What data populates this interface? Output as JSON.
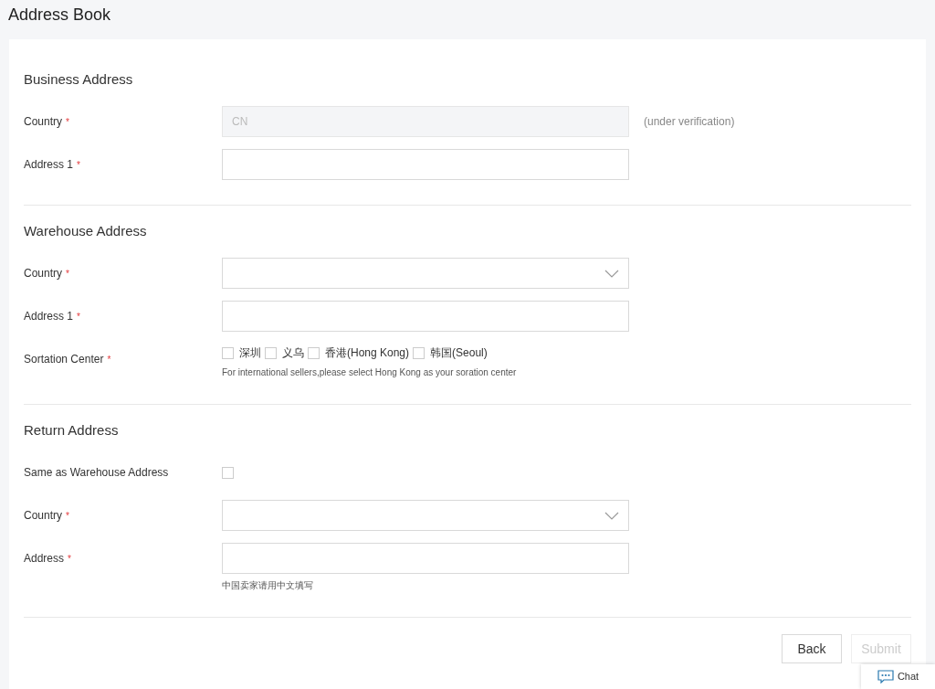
{
  "page_title": "Address Book",
  "sections": [
    {
      "title": "Business Address",
      "fields": [
        {
          "kind": "text",
          "label": "Country",
          "mark": "*",
          "value": "CN",
          "disabled": true,
          "suffix": "(under verification)"
        },
        {
          "kind": "text",
          "label": "Address 1",
          "mark": "*",
          "disabled": false
        }
      ]
    },
    {
      "title": "Warehouse Address",
      "fields": [
        {
          "kind": "select",
          "label": "Country",
          "mark": "*"
        },
        {
          "kind": "text",
          "label": "Address 1",
          "mark": "*",
          "disabled": false
        },
        {
          "kind": "checkbox_group",
          "label": "Sortation Center",
          "mark": "*",
          "options": [
            {
              "label": "深圳",
              "checked": false
            },
            {
              "label": "义乌",
              "checked": false
            },
            {
              "label": "香港(Hong Kong)",
              "checked": false
            },
            {
              "label": "韩国(Seoul)",
              "checked": false
            }
          ],
          "hint": "For international sellers,please select Hong Kong as your soration center"
        }
      ]
    },
    {
      "title": "Return Address",
      "fields": [
        {
          "kind": "checkbox",
          "label": "Same as Warehouse Address",
          "checked": false
        },
        {
          "kind": "select",
          "label": "Country",
          "mark": "*"
        },
        {
          "kind": "text",
          "label": "Address",
          "mark": "*",
          "disabled": false,
          "hint": "中国卖家请用中文填写"
        }
      ]
    }
  ],
  "buttons": [
    {
      "label": "Back",
      "disabled": false
    },
    {
      "label": "Submit",
      "disabled": true
    }
  ],
  "chat": {
    "label": "Chat"
  }
}
